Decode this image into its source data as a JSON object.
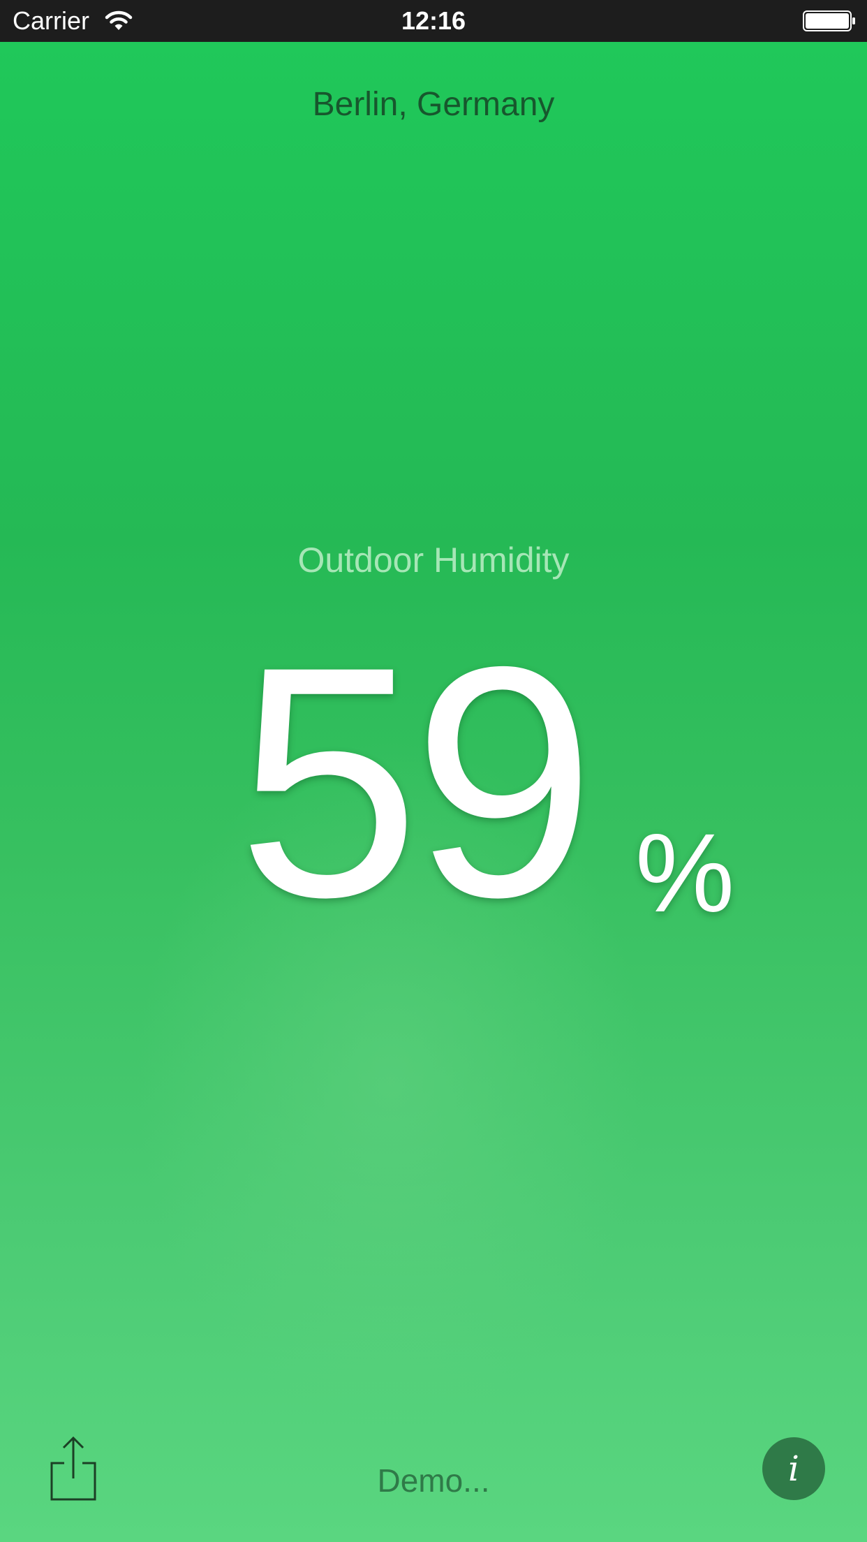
{
  "status_bar": {
    "carrier": "Carrier",
    "time": "12:16",
    "wifi_icon": "wifi-icon",
    "battery_icon": "battery-icon"
  },
  "location": "Berlin, Germany",
  "metric": {
    "label": "Outdoor Humidity",
    "value": "59",
    "unit": "%"
  },
  "toolbar": {
    "share_icon": "share-icon",
    "status_text": "Demo...",
    "info_label": "i"
  },
  "colors": {
    "background_top": "#1fc95a",
    "background_bottom": "#5ad680",
    "location_text": "#17572d",
    "info_button": "#2f7a48"
  }
}
